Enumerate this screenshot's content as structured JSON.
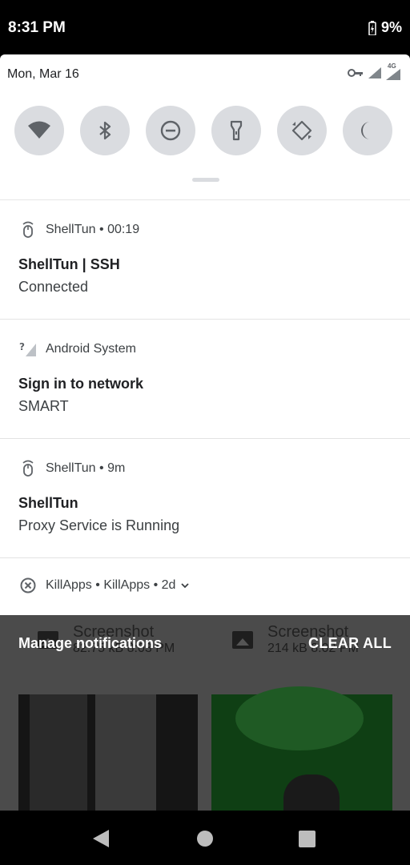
{
  "status_bar": {
    "time": "8:31 PM",
    "battery": "9%"
  },
  "quick_settings": {
    "date": "Mon, Mar 16",
    "network_label": "4G",
    "tiles": [
      "wifi-icon",
      "bluetooth-icon",
      "do-not-disturb-icon",
      "flashlight-icon",
      "auto-rotate-icon",
      "night-mode-icon"
    ]
  },
  "notifications": [
    {
      "app": "ShellTun",
      "time": "00:19",
      "title": "ShellTun | SSH",
      "text": "Connected"
    },
    {
      "app": "Android System",
      "time": "",
      "title": "Sign in to network",
      "text": "SMART"
    },
    {
      "app": "ShellTun",
      "time": "9m",
      "title": "ShellTun",
      "text": "Proxy Service is Running"
    },
    {
      "app": "KillApps",
      "sub": "KillApps",
      "time": "2d"
    }
  ],
  "footer": {
    "manage": "Manage notifications",
    "clear_all": "CLEAR ALL"
  },
  "background": {
    "card1_title": "Screenshot",
    "card1_sub": "82.75 kB  8:03 PM",
    "card2_title": "Screenshot",
    "card2_sub": "214 kB  8:02 PM"
  }
}
